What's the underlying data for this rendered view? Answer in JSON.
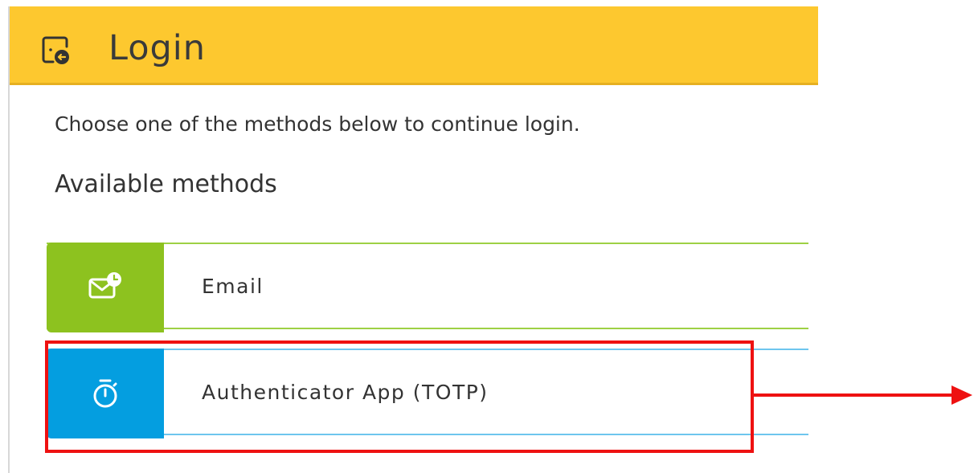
{
  "header": {
    "title": "Login",
    "icon": "login-icon"
  },
  "intro_text": "Choose one of the methods below to continue login.",
  "methods_heading": "Available methods",
  "methods": [
    {
      "label": "Email",
      "icon": "email-clock-icon",
      "color": "#8dc21f"
    },
    {
      "label": "Authenticator App (TOTP)",
      "icon": "stopwatch-icon",
      "color": "#049ee0"
    }
  ],
  "annotation": {
    "highlight_color": "#ee1111",
    "highlighted_method": "Authenticator App (TOTP)"
  }
}
